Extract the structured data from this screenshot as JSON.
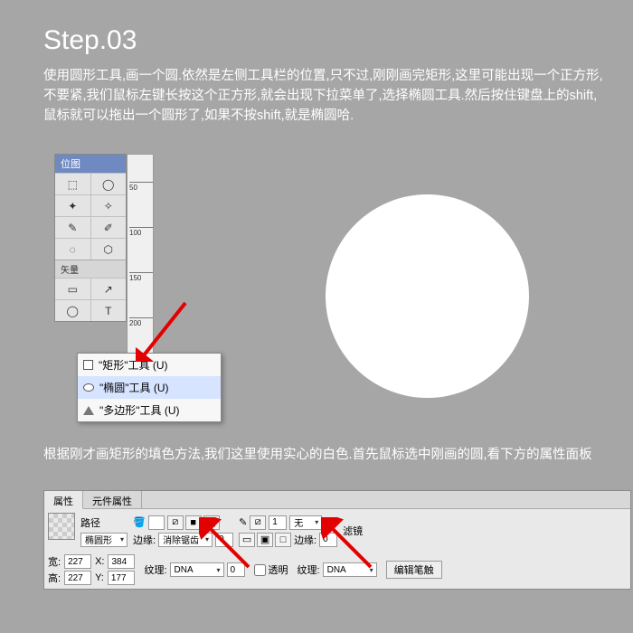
{
  "heading": "Step.03",
  "desc1": "使用圆形工具,画一个圆.依然是左侧工具栏的位置,只不过,刚刚画完矩形,这里可能出现一个正方形,不要紧,我们鼠标左键长按这个正方形,就会出现下拉菜单了,选择椭圆工具.然后按住键盘上的shift,鼠标就可以拖出一个圆形了,如果不按shift,就是椭圆哈.",
  "toolbox": {
    "title": "位图",
    "section2": "矢量",
    "tools": [
      [
        "⬚",
        "◯"
      ],
      [
        "✦",
        "✧"
      ],
      [
        "✎",
        "✐"
      ],
      [
        "◌",
        "⬡"
      ]
    ],
    "vec": [
      [
        "▭",
        "↗"
      ],
      [
        "◯",
        "T"
      ]
    ]
  },
  "ruler": {
    "ticks": [
      "50",
      "100",
      "150",
      "200"
    ]
  },
  "flyout": {
    "items": [
      {
        "icon": "sq",
        "label": "\"矩形\"工具 (U)"
      },
      {
        "icon": "el",
        "label": "\"椭圆\"工具 (U)",
        "selected": true
      },
      {
        "icon": "poly",
        "label": "\"多边形\"工具 (U)"
      }
    ]
  },
  "desc2": "根据刚才画矩形的填色方法,我们这里使用实心的白色.首先鼠标选中刚画的圆,看下方的属性面板",
  "props": {
    "tabs": [
      "属性",
      "元件属性"
    ],
    "path_label": "路径",
    "shape_label": "椭圆形",
    "edge_label": "边缘:",
    "edge_value": "消除锯齿",
    "edge2_label": "边缘:",
    "stroke_none": "无",
    "texture_label": "纹理:",
    "texture_value": "DNA",
    "texture_amt": "0",
    "texture2_label": "纹理:",
    "texture2_value": "DNA",
    "transparent": "透明",
    "edit_brush": "编辑笔触",
    "filter_label": "滤镜",
    "dims": {
      "w_label": "宽:",
      "w": "227",
      "h_label": "高:",
      "h": "227",
      "x_label": "X:",
      "x": "384",
      "y_label": "Y:",
      "y": "177"
    },
    "stroke_width": "1"
  }
}
